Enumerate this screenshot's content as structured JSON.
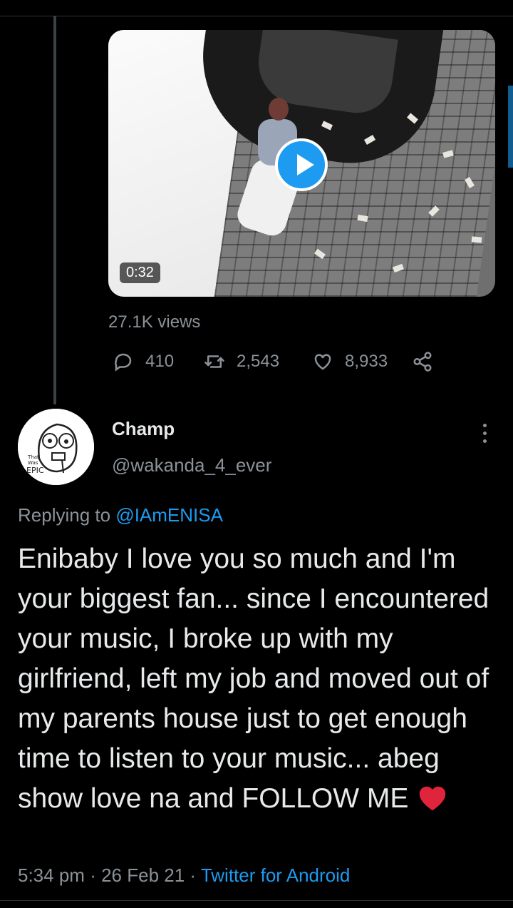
{
  "media": {
    "duration": "0:32",
    "views": "27.1K views"
  },
  "counts": {
    "replies": "410",
    "retweets": "2,543",
    "likes": "8,933"
  },
  "reply": {
    "display_name": "Champ",
    "handle": "@wakanda_4_ever",
    "avatar_text": "That Was EPIC",
    "replying_label": "Replying to",
    "replying_to": "@IAmENISA",
    "text": "Enibaby I love you so much and I'm your biggest fan... since I encountered your music, I broke up with my girlfriend, left my job and moved out of my parents house just to get enough time to listen to your music... abeg show love na and FOLLOW ME",
    "time": "5:34 pm",
    "date": "26 Feb 21",
    "source": "Twitter for Android"
  },
  "colors": {
    "accent": "#1d9bf0",
    "heart_emoji": "#e0243b",
    "muted": "#8b9298"
  },
  "icons": [
    "reply-icon",
    "retweet-icon",
    "like-icon",
    "share-icon",
    "more-icon",
    "play-icon",
    "heart-emoji"
  ]
}
